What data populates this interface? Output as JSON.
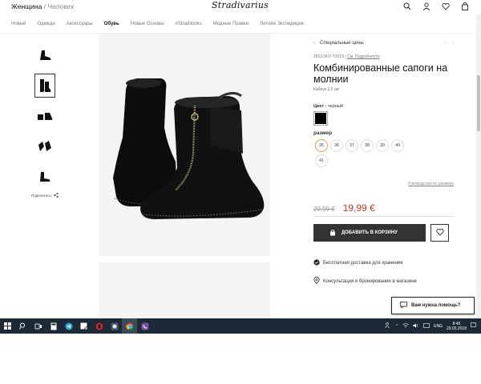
{
  "header": {
    "gender_active": "Женщина",
    "gender_sep": " / ",
    "gender_other": "Человек",
    "logo": "Stradivarius"
  },
  "nav": {
    "items": [
      "Новый",
      "Одежда",
      "Аксессуары",
      "Обувь",
      "Новые Основы",
      "#Stradilooks",
      "Модные Правки",
      "Летняя Экспедиция"
    ],
    "active_index": 3
  },
  "gallery": {
    "thumb_count": 5,
    "active_thumb": 1,
    "share_label": "Поделитесь:"
  },
  "product": {
    "section": "Специальные цены",
    "reference": "2811/341/-Y2018 |",
    "details_link": "См. Подробности",
    "title": "Комбинированные сапоги на молнии",
    "heel": "Каблук 2,5 см",
    "color_label": "Цвет :",
    "color_value": "черный",
    "color_hex": "#000000",
    "size_label": "размер",
    "sizes": [
      "35",
      "36",
      "37",
      "38",
      "39",
      "40",
      "41"
    ],
    "selected_size": "35",
    "size_guide": "Руководство по размеру",
    "old_price": "29,99 €",
    "new_price": "19,99 €",
    "add_to_cart": "ДОБАВИТЬ В КОРЗИНУ",
    "features": [
      "Бесплатная доставка для хранения",
      "Консультация и бронирование в магазине"
    ]
  },
  "help": {
    "label": "Вам нужна помощь?"
  },
  "taskbar": {
    "language": "ENG",
    "time": "8:46",
    "date": "29.05.2018"
  },
  "colors": {
    "price_red": "#c0392b",
    "taskbar_bg": "#1b2a36",
    "button_bg": "#333333"
  }
}
